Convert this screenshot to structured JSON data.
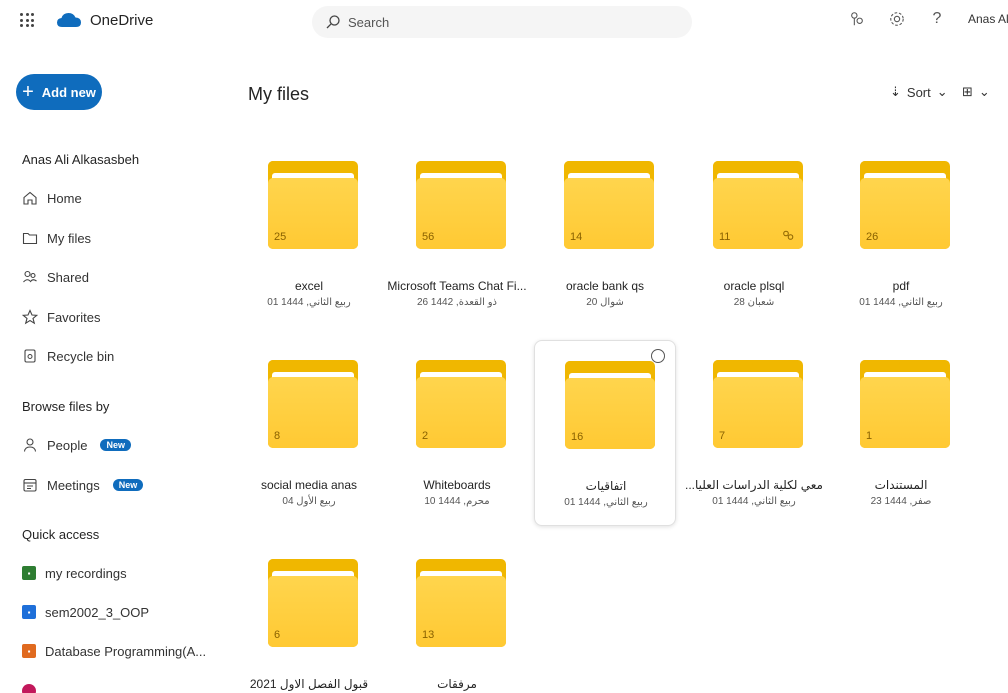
{
  "header": {
    "app_name": "OneDrive",
    "search_placeholder": "Search",
    "user_name": "Anas Ali"
  },
  "sidebar": {
    "add_new_label": "Add new",
    "account_name": "Anas Ali Alkasasbeh",
    "nav": [
      {
        "label": "Home",
        "icon": "home-icon"
      },
      {
        "label": "My files",
        "icon": "folder-icon"
      },
      {
        "label": "Shared",
        "icon": "people-icon"
      },
      {
        "label": "Favorites",
        "icon": "star-icon"
      },
      {
        "label": "Recycle bin",
        "icon": "recycle-bin-icon"
      }
    ],
    "browse_heading": "Browse files by",
    "browse": [
      {
        "label": "People",
        "badge": "New",
        "icon": "person-icon"
      },
      {
        "label": "Meetings",
        "badge": "New",
        "icon": "calendar-icon"
      }
    ],
    "quick_access_heading": "Quick access",
    "quick_access": [
      {
        "label": "my recordings",
        "color": "#2e7d32"
      },
      {
        "label": "sem2002_3_OOP",
        "color": "#1e6fd9"
      },
      {
        "label": "Database Programming(A...",
        "color": "#e06a1f"
      }
    ]
  },
  "main": {
    "title": "My files",
    "sort_label": "Sort",
    "folders": [
      {
        "name": "excel",
        "date": "01 ربيع الثاني, 1444",
        "count": "25",
        "shared": false,
        "selected": false
      },
      {
        "name": "Microsoft Teams Chat Fi...",
        "date": "26 ذو القعدة, 1442",
        "count": "56",
        "shared": false,
        "selected": false
      },
      {
        "name": "oracle bank qs",
        "date": "20 شوال",
        "count": "14",
        "shared": false,
        "selected": false
      },
      {
        "name": "oracle plsql",
        "date": "28 شعبان",
        "count": "11",
        "shared": true,
        "selected": false
      },
      {
        "name": "pdf",
        "date": "01 ربيع الثاني, 1444",
        "count": "26",
        "shared": false,
        "selected": false
      },
      {
        "name": "social media anas",
        "date": "04 ربيع الأول",
        "count": "8",
        "shared": false,
        "selected": false
      },
      {
        "name": "Whiteboards",
        "date": "10 محرم, 1444",
        "count": "2",
        "shared": false,
        "selected": false
      },
      {
        "name": "اتفاقيات",
        "date": "01 ربيع الثاني, 1444",
        "count": "16",
        "shared": false,
        "selected": true
      },
      {
        "name": "...معي لكلية الدراسات العليا",
        "date": "01 ربيع الثاني, 1444",
        "count": "7",
        "shared": false,
        "selected": false
      },
      {
        "name": "المستندات",
        "date": "23 صفر, 1444",
        "count": "1",
        "shared": false,
        "selected": false
      },
      {
        "name": "قبول الفصل الاول 2021",
        "date": "",
        "count": "6",
        "shared": false,
        "selected": false
      },
      {
        "name": "مرفقات",
        "date": "",
        "count": "13",
        "shared": false,
        "selected": false
      }
    ]
  },
  "colors": {
    "accent": "#0f6cbd",
    "folder": "#ffc933"
  }
}
